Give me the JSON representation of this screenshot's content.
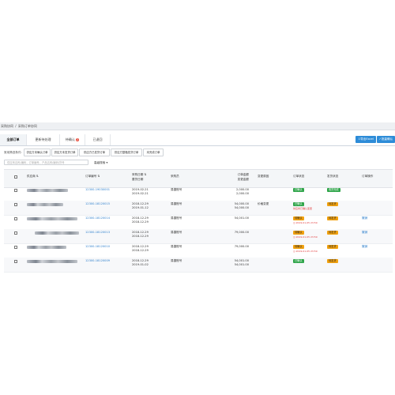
{
  "breadcrumb": {
    "root": "采购协同",
    "sep": "/",
    "current": "采购订单协同"
  },
  "tabs": [
    {
      "label": "全部订单",
      "badge": ""
    },
    {
      "label": "更新待处理",
      "badge": ""
    },
    {
      "label": "待确认",
      "badge": "2"
    },
    {
      "label": "已退回",
      "badge": ""
    }
  ],
  "toolbar": {
    "export_label": "导出Excel",
    "batch_label": "批量确认"
  },
  "quick_filter": {
    "label": "常用筛选条件:",
    "buttons": [
      "供应方未确认订单",
      "供应方未发货订单",
      "供应方已发货订单",
      "供应方整箱发货订单",
      "未完成订单"
    ]
  },
  "search": {
    "placeholder": "供应商名称/编码，订单编号，产品名称/编码/货号",
    "advanced_label": "高级搜索"
  },
  "table": {
    "headers": {
      "supplier": "供应商",
      "order_no": "订单编号",
      "purchase_date": "采购日期",
      "delivery_date": "要货日期",
      "buyer": "采购员",
      "amount": "订单金额",
      "adjusted_amount": "变更金额",
      "change_reason": "变更原因",
      "order_status": "订单状态",
      "delivery_status": "发货状态",
      "actions": "订单操作"
    },
    "rows": [
      {
        "order_no": "12300-19030001",
        "date1": "2019-02-21",
        "date2": "2019-02-21",
        "buyer": "易捷账号",
        "amount1": "2,000.00",
        "amount2": "2,000.00",
        "reason": "",
        "status": "已确认",
        "status_note": "",
        "delivery": "收货完成",
        "action": ""
      },
      {
        "order_no": "12300-18120015",
        "date1": "2018-12-29",
        "date2": "2019-01-12",
        "buyer": "易捷账号",
        "amount1": "54,000.00",
        "amount2": "54,000.00",
        "reason": "价格变更",
        "status": "已确认",
        "status_note": "供应商已确认变更",
        "delivery": "待发货",
        "action": ""
      },
      {
        "order_no": "12300-18120014",
        "date1": "2018-12-29",
        "date2": "2018-12-29",
        "buyer": "易捷账号",
        "amount1": "54,001.00",
        "amount2": "",
        "reason": "",
        "status": "待确认",
        "status_note": "2019-01-05 23:59",
        "delivery": "待发货",
        "action": "撤销"
      },
      {
        "order_no": "12300-18120013",
        "date1": "2018-12-29",
        "date2": "2018-12-29",
        "buyer": "易捷账号",
        "amount1": "79,000.00",
        "amount2": "",
        "reason": "",
        "status": "待确认",
        "status_note": "2019-01-05 23:59",
        "delivery": "待发货",
        "action": "撤销"
      },
      {
        "order_no": "12300-18120010",
        "date1": "2018-12-29",
        "date2": "2018-12-29",
        "buyer": "易捷账号",
        "amount1": "79,000.00",
        "amount2": "",
        "reason": "",
        "status": "待确认",
        "status_note": "2019-01-05 23:59",
        "delivery": "待发货",
        "action": "撤销"
      },
      {
        "order_no": "12300-18120009",
        "date1": "2018-12-29",
        "date2": "2019-01-02",
        "buyer": "易捷账号",
        "amount1": "54,001.00",
        "amount2": "54,001.00",
        "reason": "",
        "status": "已确认",
        "status_note": "",
        "delivery": "待发货",
        "action": ""
      }
    ]
  }
}
